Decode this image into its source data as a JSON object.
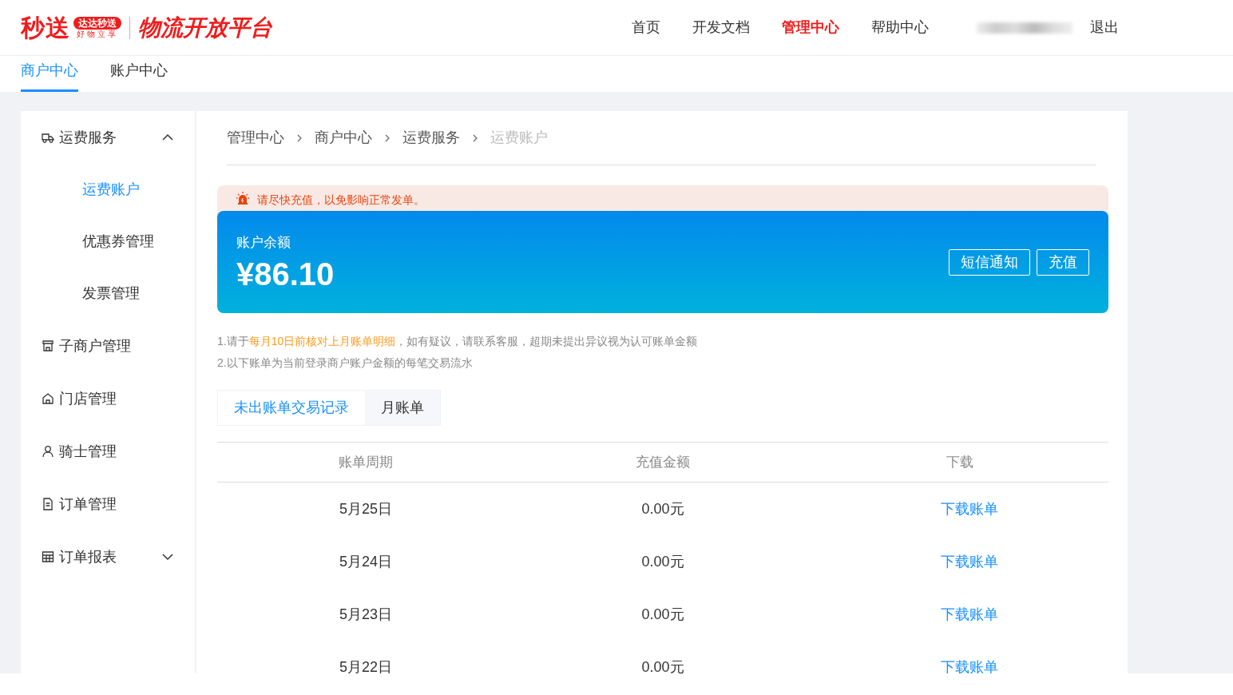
{
  "logo": {
    "brand": "秒送",
    "badge": "达达秒送",
    "slogan": "好物立享",
    "platform": "物流开放平台"
  },
  "nav": [
    {
      "label": "首页",
      "selected": false
    },
    {
      "label": "开发文档",
      "selected": false
    },
    {
      "label": "管理中心",
      "selected": true
    },
    {
      "label": "帮助中心",
      "selected": false
    }
  ],
  "logout": "退出",
  "subtabs": [
    {
      "label": "商户中心",
      "selected": true
    },
    {
      "label": "账户中心",
      "selected": false
    }
  ],
  "sidebar": [
    {
      "label": "运费服务",
      "kind": "truck",
      "expanded": true,
      "children": [
        {
          "label": "运费账户",
          "selected": true
        },
        {
          "label": "优惠券管理",
          "selected": false
        },
        {
          "label": "发票管理",
          "selected": false
        }
      ]
    },
    {
      "label": "子商户管理",
      "kind": "shop"
    },
    {
      "label": "门店管理",
      "kind": "home"
    },
    {
      "label": "骑士管理",
      "kind": "person"
    },
    {
      "label": "订单管理",
      "kind": "doc"
    },
    {
      "label": "订单报表",
      "kind": "grid",
      "expanded": false
    }
  ],
  "breadcrumb": [
    "管理中心",
    "商户中心",
    "运费服务",
    "运费账户"
  ],
  "alert": "请尽快充值，以免影响正常发单。",
  "balance": {
    "label": "账户余额",
    "amount": "¥86.10",
    "buttons": [
      "短信通知",
      "充值"
    ]
  },
  "notes": [
    {
      "before": "1.请于",
      "highlight": "每月10日前核对上月账单明细",
      "after": "，如有疑议，请联系客服，超期未提出异议视为认可账单金额"
    },
    {
      "before": "2.以下账单为当前登录商户账户金额的每笔交易流水"
    }
  ],
  "tabs": [
    {
      "label": "未出账单交易记录",
      "selected": true
    },
    {
      "label": "月账单",
      "selected": false
    }
  ],
  "table": {
    "columns": [
      "账单周期",
      "充值金额",
      "下载"
    ],
    "rows": [
      [
        "5月25日",
        "0.00元",
        "下载账单"
      ],
      [
        "5月24日",
        "0.00元",
        "下载账单"
      ],
      [
        "5月23日",
        "0.00元",
        "下载账单"
      ],
      [
        "5月22日",
        "0.00元",
        "下载账单"
      ]
    ]
  }
}
